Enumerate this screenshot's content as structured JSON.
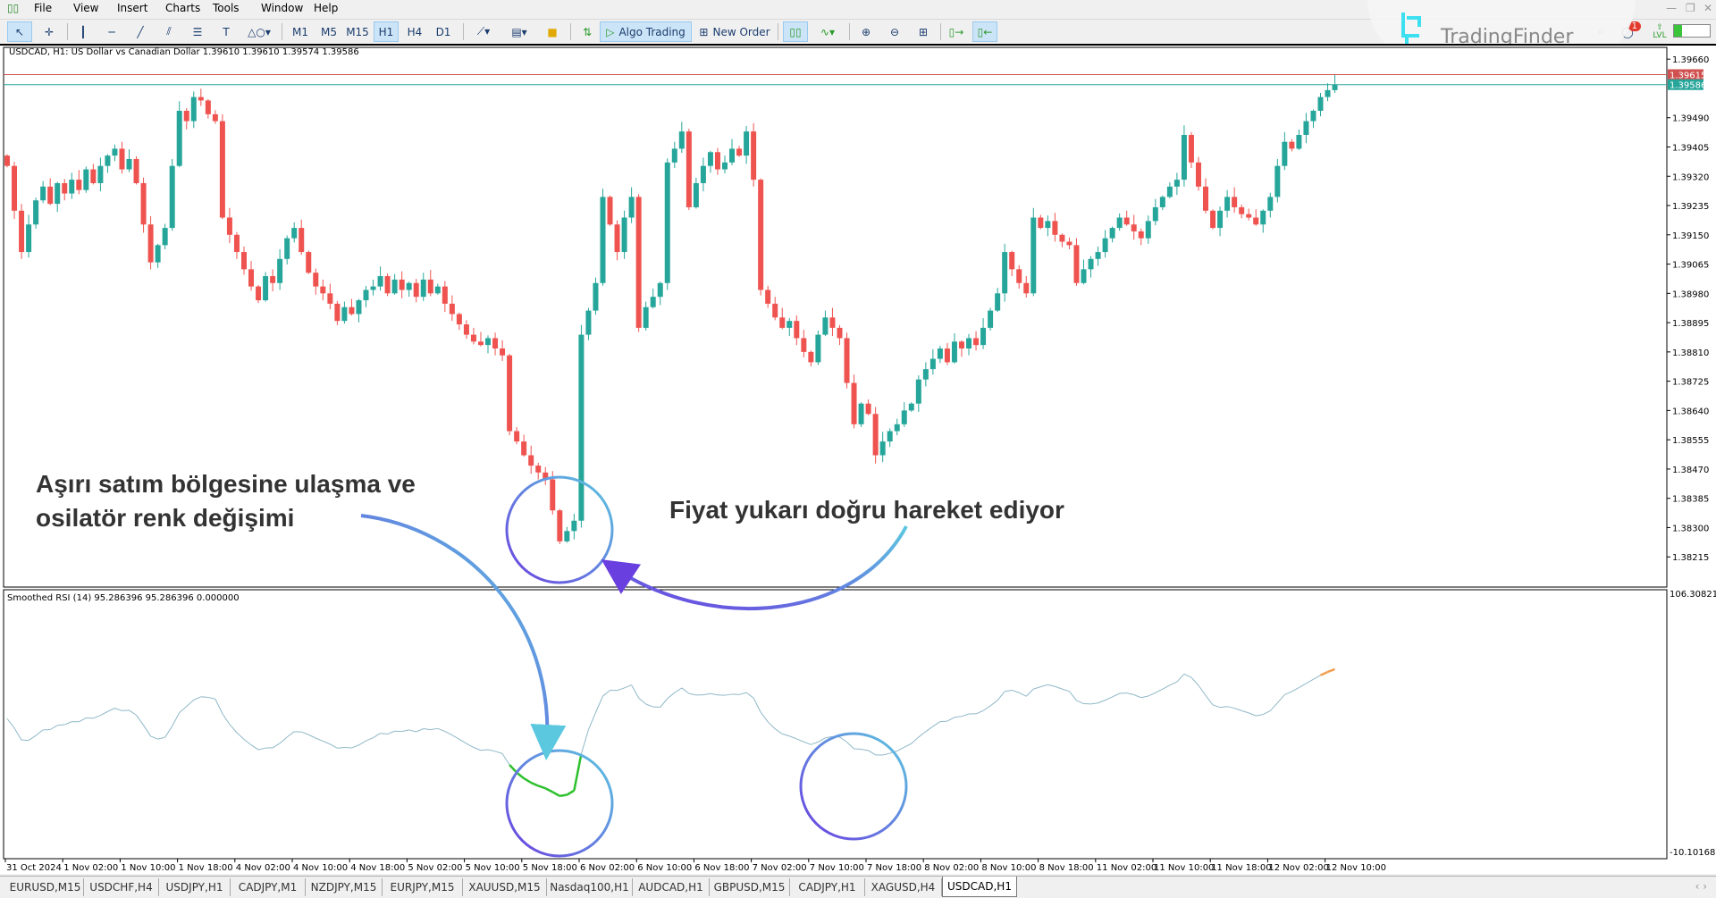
{
  "menu": [
    "File",
    "View",
    "Insert",
    "Charts",
    "Tools",
    "Window",
    "Help"
  ],
  "toolbar": {
    "timeframes": [
      "M1",
      "M5",
      "M15",
      "H1",
      "H4",
      "D1"
    ],
    "active_timeframe": "H1",
    "algo_trading": "Algo Trading",
    "new_order": "New Order",
    "notification_count": "1",
    "lvl_label": "LVL"
  },
  "logo": {
    "text": "TradingFinder"
  },
  "chart": {
    "header": "USDCAD, H1:  US Dollar vs Canadian Dollar  1.39610 1.39610 1.39574 1.39586",
    "price_ticks": [
      "1.39660",
      "1.39490",
      "1.39405",
      "1.39320",
      "1.39235",
      "1.39150",
      "1.39065",
      "1.38980",
      "1.38895",
      "1.38810",
      "1.38725",
      "1.38640",
      "1.38555",
      "1.38470",
      "1.38385",
      "1.38300",
      "1.38215"
    ],
    "ask_label": "1.39615",
    "bid_label": "1.39586",
    "ask": 1.39615,
    "bid": 1.39586,
    "bull_color": "#26a69a",
    "bear_color": "#ef5350",
    "closes": [
      1.3935,
      1.3922,
      1.391,
      1.3918,
      1.3925,
      1.3929,
      1.3924,
      1.393,
      1.3927,
      1.3931,
      1.3928,
      1.3934,
      1.393,
      1.3935,
      1.3938,
      1.394,
      1.3934,
      1.3937,
      1.393,
      1.3918,
      1.3907,
      1.3912,
      1.3917,
      1.3935,
      1.3951,
      1.3948,
      1.3955,
      1.3954,
      1.395,
      1.3948,
      1.392,
      1.3915,
      1.391,
      1.3905,
      1.39,
      1.3896,
      1.3903,
      1.3901,
      1.3908,
      1.3914,
      1.3917,
      1.391,
      1.3904,
      1.39,
      1.3898,
      1.3895,
      1.389,
      1.3894,
      1.3892,
      1.3896,
      1.3899,
      1.39,
      1.3903,
      1.3898,
      1.3902,
      1.3899,
      1.3901,
      1.3897,
      1.3902,
      1.3898,
      1.39,
      1.3895,
      1.3892,
      1.3889,
      1.3886,
      1.3884,
      1.3883,
      1.3885,
      1.3882,
      1.388,
      1.3858,
      1.3855,
      1.3851,
      1.3848,
      1.3846,
      1.3844,
      1.3835,
      1.3826,
      1.3829,
      1.3832,
      1.3886,
      1.3893,
      1.3901,
      1.3926,
      1.3918,
      1.391,
      1.392,
      1.3926,
      1.3888,
      1.3894,
      1.3897,
      1.3901,
      1.3936,
      1.394,
      1.3945,
      1.3923,
      1.393,
      1.3935,
      1.3939,
      1.3934,
      1.3936,
      1.394,
      1.3938,
      1.3945,
      1.3931,
      1.3899,
      1.3895,
      1.3891,
      1.3888,
      1.389,
      1.3885,
      1.3881,
      1.3878,
      1.3886,
      1.3891,
      1.3888,
      1.3885,
      1.3872,
      1.386,
      1.3866,
      1.3863,
      1.3851,
      1.3855,
      1.3858,
      1.386,
      1.3864,
      1.3866,
      1.3873,
      1.3876,
      1.3879,
      1.3882,
      1.3878,
      1.3884,
      1.3882,
      1.3885,
      1.3883,
      1.3888,
      1.3893,
      1.3898,
      1.391,
      1.3905,
      1.3901,
      1.3898,
      1.392,
      1.3917,
      1.3919,
      1.3915,
      1.3913,
      1.3912,
      1.3901,
      1.3905,
      1.3908,
      1.391,
      1.3914,
      1.3917,
      1.392,
      1.3918,
      1.3916,
      1.3914,
      1.3919,
      1.3923,
      1.3926,
      1.3929,
      1.3931,
      1.3944,
      1.3936,
      1.3929,
      1.3922,
      1.3917,
      1.3922,
      1.3926,
      1.3923,
      1.3921,
      1.392,
      1.3918,
      1.3922,
      1.3926,
      1.3935,
      1.3942,
      1.394,
      1.3944,
      1.3948,
      1.3951,
      1.3955,
      1.3957,
      1.39586
    ]
  },
  "indicator": {
    "header": "Smoothed RSI (14) 95.286396 95.286396 0.000000",
    "max_label": "106.308219",
    "min_label": "-10.101686",
    "max": 106.308219,
    "min": -10.101686,
    "overbought": 70,
    "oversold": 30,
    "colors": {
      "neutral": "#8fb8c8",
      "overbought": "#f0a050",
      "oversold": "#2ec02e"
    }
  },
  "time_labels": [
    "31 Oct 2024",
    "1 Nov 02:00",
    "1 Nov 10:00",
    "1 Nov 18:00",
    "4 Nov 02:00",
    "4 Nov 10:00",
    "4 Nov 18:00",
    "5 Nov 02:00",
    "5 Nov 10:00",
    "5 Nov 18:00",
    "6 Nov 02:00",
    "6 Nov 10:00",
    "6 Nov 18:00",
    "7 Nov 02:00",
    "7 Nov 10:00",
    "7 Nov 18:00",
    "8 Nov 02:00",
    "8 Nov 10:00",
    "8 Nov 18:00",
    "11 Nov 02:00",
    "11 Nov 10:00",
    "11 Nov 18:00",
    "12 Nov 02:00",
    "12 Nov 10:00"
  ],
  "annotations": {
    "left_line1": "Aşırı satım bölgesine ulaşma ve",
    "left_line2": "osilatör renk değişimi",
    "right": "Fiyat yukarı doğru hareket ediyor",
    "gradient": [
      "#6a3fe0",
      "#5cc8e0"
    ]
  },
  "tabs": [
    "EURUSD,M15",
    "USDCHF,H4",
    "USDJPY,H1",
    "CADJPY,M1",
    "NZDJPY,M15",
    "EURJPY,M15",
    "XAUUSD,M15",
    "Nasdaq100,H1",
    "AUDCAD,H1",
    "GBPUSD,M15",
    "CADJPY,H1",
    "XAGUSD,H4",
    "USDCAD,H1"
  ],
  "active_tab": "USDCAD,H1"
}
